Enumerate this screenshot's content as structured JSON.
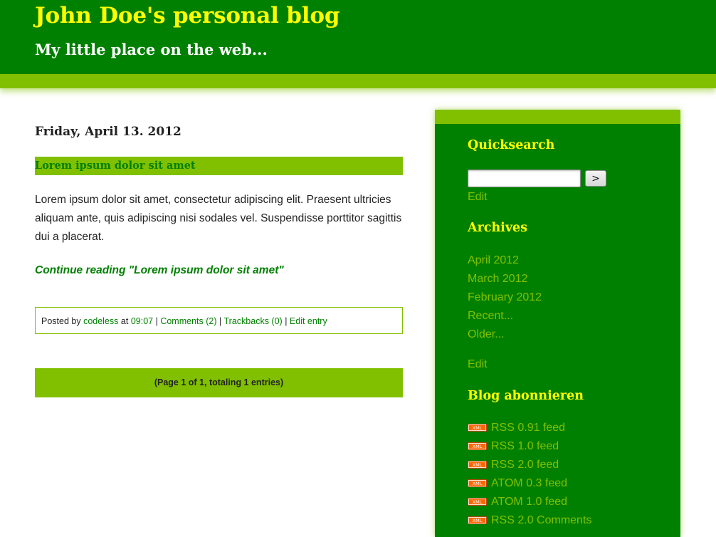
{
  "header": {
    "title": "John Doe's personal blog",
    "tagline": "My little place on the web..."
  },
  "entry": {
    "date": "Friday, April 13. 2012",
    "title": "Lorem ipsum dolor sit amet",
    "body": "Lorem ipsum dolor sit amet, consectetur adipiscing elit. Praesent ultricies aliquam ante, quis adipiscing nisi sodales vel. Suspendisse porttitor sagittis dui a placerat.",
    "continue_label": "Continue reading \"Lorem ipsum dolor sit amet\"",
    "footer": {
      "posted_by": "Posted by",
      "author": "codeless",
      "at": "at",
      "time": "09:07",
      "sep": "|",
      "comments": "Comments (2)",
      "trackbacks": "Trackbacks (0)",
      "edit": "Edit entry"
    }
  },
  "pager": {
    "text": "(Page 1 of 1, totaling 1 entries)"
  },
  "sidebar": {
    "quicksearch": {
      "title": "Quicksearch",
      "input_value": "",
      "button_label": ">",
      "edit_label": "Edit"
    },
    "archives": {
      "title": "Archives",
      "items": [
        "April 2012",
        "March 2012",
        "February 2012",
        "Recent...",
        "Older..."
      ],
      "edit_label": "Edit"
    },
    "subscribe": {
      "title": "Blog abonnieren",
      "icon_text": "XML",
      "feeds": [
        "RSS 0.91 feed",
        "RSS 1.0 feed",
        "RSS 2.0 feed",
        "ATOM 0.3 feed",
        "ATOM 1.0 feed",
        "RSS 2.0 Comments"
      ]
    }
  },
  "colors": {
    "dark_green": "#008000",
    "light_green": "#80c000",
    "yellow": "#ffff00",
    "text": "#222222"
  }
}
